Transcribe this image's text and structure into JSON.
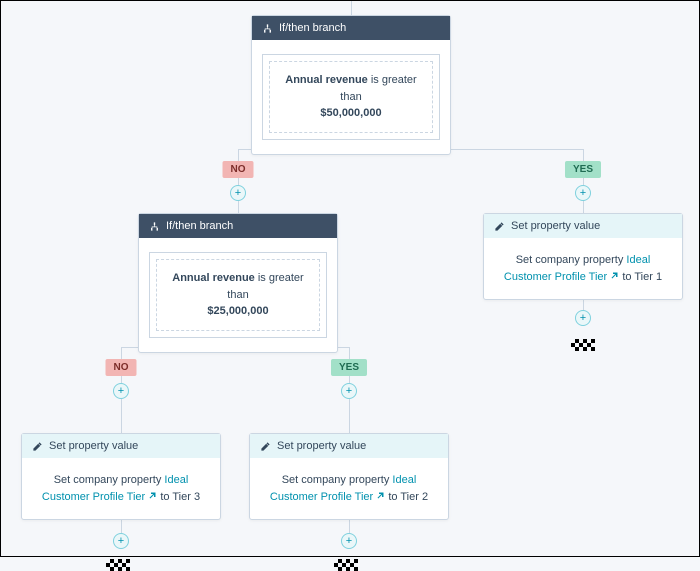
{
  "labels": {
    "no": "NO",
    "yes": "YES"
  },
  "branch1": {
    "title": "If/then branch",
    "condition_field": "Annual revenue",
    "condition_text": "is greater than",
    "condition_value": "$50,000,000"
  },
  "branch2": {
    "title": "If/then branch",
    "condition_field": "Annual revenue",
    "condition_text": "is greater than",
    "condition_value": "$25,000,000"
  },
  "action": {
    "title": "Set property value",
    "prefix": "Set company property",
    "property": "Ideal Customer Profile Tier",
    "to": "to"
  },
  "tiers": {
    "yes1": "Tier 1",
    "yes2": "Tier 2",
    "no2": "Tier 3"
  }
}
